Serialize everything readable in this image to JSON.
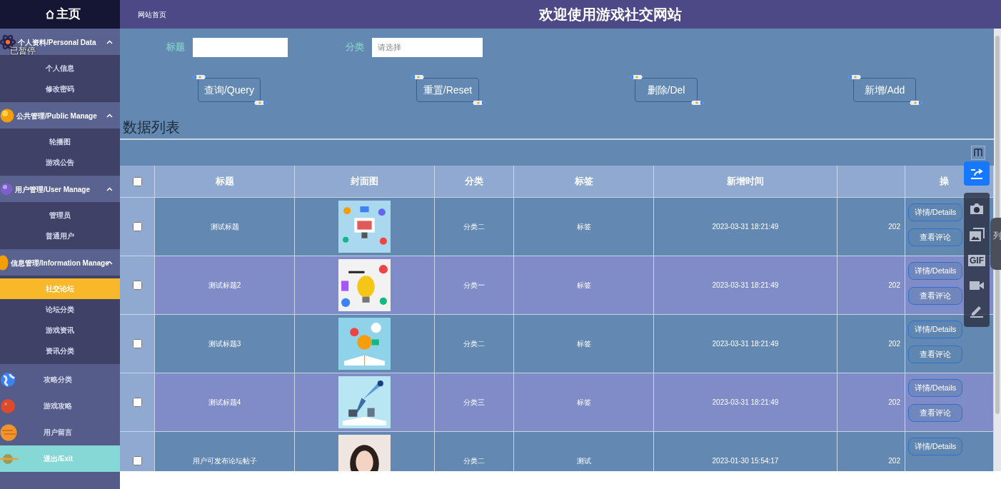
{
  "sidebar": {
    "home": "主页",
    "paused_label": "已暂停",
    "groups": [
      {
        "label": "个人资料/Personal Data",
        "expanded": true,
        "items": [
          {
            "label": "个人信息",
            "selected": false
          },
          {
            "label": "修改密码",
            "selected": false
          }
        ]
      },
      {
        "label": "公共管理/Public Manage",
        "expanded": true,
        "items": [
          {
            "label": "轮播图",
            "selected": false
          },
          {
            "label": "游戏公告",
            "selected": false
          }
        ]
      },
      {
        "label": "用户管理/User Manage",
        "expanded": true,
        "items": [
          {
            "label": "管理员",
            "selected": false
          },
          {
            "label": "普通用户",
            "selected": false
          }
        ]
      },
      {
        "label": "信息管理/Information Manage",
        "expanded": true,
        "items": [
          {
            "label": "社交论坛",
            "selected": true
          },
          {
            "label": "论坛分类",
            "selected": false
          },
          {
            "label": "游戏资讯",
            "selected": false
          },
          {
            "label": "资讯分类",
            "selected": false
          }
        ]
      }
    ],
    "items": [
      {
        "label": "攻略分类",
        "kind": "plain"
      },
      {
        "label": "游戏攻略",
        "kind": "plain"
      },
      {
        "label": "用户留言",
        "kind": "plain"
      },
      {
        "label": "退出/Exit",
        "kind": "exit"
      }
    ]
  },
  "header": {
    "link": "网站首页",
    "title": "欢迎使用游戏社交网站"
  },
  "search": {
    "fields": [
      {
        "label": "标题"
      },
      {
        "label": "分类",
        "placeholder": "请选择"
      }
    ],
    "buttons": [
      "查询/Query",
      "重置/Reset",
      "删除/Del",
      "新增/Add"
    ]
  },
  "list_title": "数据列表",
  "table": {
    "select_all_checked": false,
    "columns": [
      "",
      "标题",
      "封面图",
      "分类",
      "标签",
      "新增时间",
      "",
      "操"
    ],
    "rows": [
      {
        "checked": false,
        "title": "测试标题",
        "category": "分类二",
        "tag": "标签",
        "time": "2023-03-31 18:21:49",
        "column_7": "202",
        "actions": [
          "详情/Details",
          "查看评论"
        ]
      },
      {
        "checked": false,
        "title": "测试标题2",
        "category": "分类一",
        "tag": "标签",
        "time": "2023-03-31 18:21:49",
        "column_7": "202",
        "actions": [
          "详情/Details",
          "查看评论"
        ]
      },
      {
        "checked": false,
        "title": "测试标题3",
        "category": "分类二",
        "tag": "标签",
        "time": "2023-03-31 18:21:49",
        "column_7": "202",
        "actions": [
          "详情/Details",
          "查看评论"
        ]
      },
      {
        "checked": false,
        "title": "测试标题4",
        "category": "分类三",
        "tag": "标签",
        "time": "2023-03-31 18:21:49",
        "column_7": "202",
        "actions": [
          "详情/Details",
          "查看评论"
        ]
      },
      {
        "checked": false,
        "title": "用户可发布论坛帖子",
        "category": "分类二",
        "tag": "测试",
        "time": "2023-01-30 15:54:17",
        "column_7": "202",
        "actions": [
          "详情/Details"
        ]
      }
    ]
  },
  "capture_toolbar": {
    "gif": "GIF"
  },
  "side_tab": "列"
}
